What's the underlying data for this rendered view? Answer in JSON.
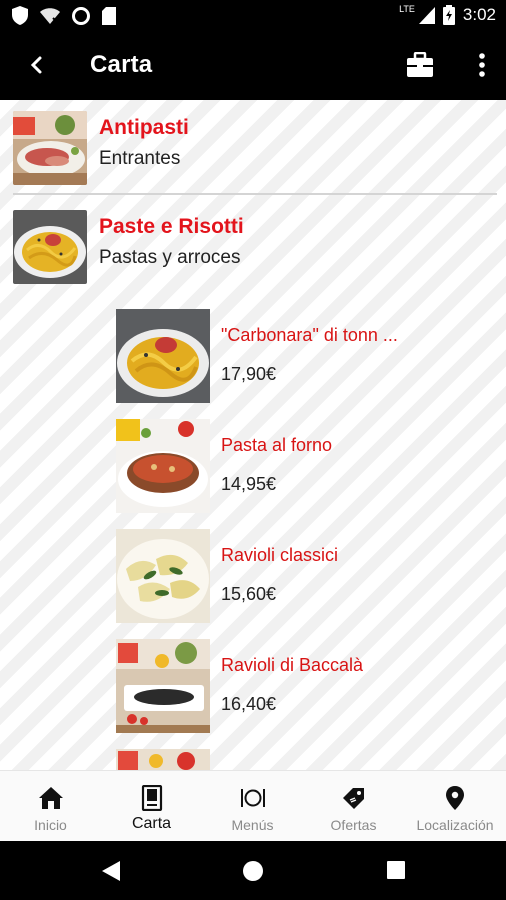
{
  "status_bar": {
    "time": "3:02",
    "network": "LTE"
  },
  "app_bar": {
    "title": "Carta"
  },
  "categories": [
    {
      "name": "Antipasti",
      "subtitle": "Entrantes"
    },
    {
      "name": "Paste e Risotti",
      "subtitle": "Pastas y arroces"
    }
  ],
  "dishes": [
    {
      "name": "\"Carbonara\" di tonn ...",
      "price": "17,90€"
    },
    {
      "name": "Pasta al forno",
      "price": "14,95€"
    },
    {
      "name": "Ravioli classici",
      "price": "15,60€"
    },
    {
      "name": "Ravioli di Baccalà",
      "price": "16,40€"
    }
  ],
  "bottom_nav": {
    "items": [
      {
        "label": "Inicio",
        "icon": "home-icon"
      },
      {
        "label": "Carta",
        "icon": "menu-card-icon",
        "active": true
      },
      {
        "label": "Menús",
        "icon": "cutlery-plate-icon"
      },
      {
        "label": "Ofertas",
        "icon": "offer-tag-icon"
      },
      {
        "label": "Localización",
        "icon": "location-pin-icon"
      }
    ]
  },
  "colors": {
    "accent_red": "#e3141c",
    "app_bar": "#000000",
    "nav_bg": "#fafafa"
  }
}
